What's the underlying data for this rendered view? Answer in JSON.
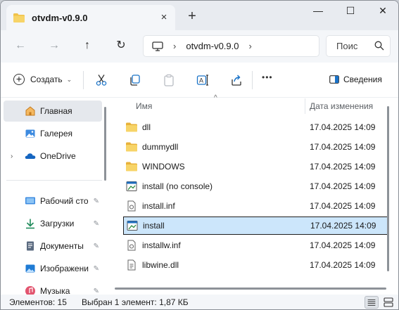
{
  "window": {
    "tab_title": "otvdm-v0.9.0",
    "tab_close": "×",
    "new_tab": "+",
    "minimize": "—",
    "maximize": "☐",
    "close": "✕"
  },
  "nav_buttons": {
    "back": "←",
    "forward": "→",
    "up": "↑",
    "refresh": "↻"
  },
  "address": {
    "separator": "›",
    "crumb": "otvdm-v0.9.0",
    "separator_after": "›"
  },
  "search": {
    "placeholder": "Поис"
  },
  "toolbar": {
    "create_label": "Создать",
    "create_chevron": "⌄",
    "more": "•••",
    "details_label": "Сведения"
  },
  "sidebar": {
    "items": [
      {
        "label": "Главная",
        "icon": "home-icon",
        "selected": true
      },
      {
        "label": "Галерея",
        "icon": "gallery-icon"
      },
      {
        "label": "OneDrive",
        "icon": "onedrive-icon",
        "expander": "›"
      },
      {
        "label": "Рабочий сто",
        "icon": "desktop-icon",
        "pin": "📌"
      },
      {
        "label": "Загрузки",
        "icon": "downloads-icon",
        "pin": "📌"
      },
      {
        "label": "Документы",
        "icon": "documents-icon",
        "pin": "📌"
      },
      {
        "label": "Изображени",
        "icon": "pictures-icon",
        "pin": "📌"
      },
      {
        "label": "Музыка",
        "icon": "music-icon",
        "pin": "📌"
      }
    ]
  },
  "filelist": {
    "columns": {
      "name": "Имя",
      "date": "Дата изменения"
    },
    "sort_arrow": "^",
    "rows": [
      {
        "name": "dll",
        "date": "17.04.2025 14:09",
        "icon": "folder-icon"
      },
      {
        "name": "dummydll",
        "date": "17.04.2025 14:09",
        "icon": "folder-icon"
      },
      {
        "name": "WINDOWS",
        "date": "17.04.2025 14:09",
        "icon": "folder-icon"
      },
      {
        "name": "install (no console)",
        "date": "17.04.2025 14:09",
        "icon": "app-icon"
      },
      {
        "name": "install.inf",
        "date": "17.04.2025 14:09",
        "icon": "settings-file-icon"
      },
      {
        "name": "install",
        "date": "17.04.2025 14:09",
        "icon": "app-icon",
        "selected": true
      },
      {
        "name": "installw.inf",
        "date": "17.04.2025 14:09",
        "icon": "settings-file-icon"
      },
      {
        "name": "libwine.dll",
        "date": "17.04.2025 14:09",
        "icon": "dll-file-icon"
      }
    ]
  },
  "status": {
    "count": "Элементов: 15",
    "selection": "Выбран 1 элемент: 1,87 КБ"
  },
  "colors": {
    "selection_bg": "#cce6fb",
    "folder": "#f0c24a",
    "accent_blue": "#1a73c8"
  }
}
